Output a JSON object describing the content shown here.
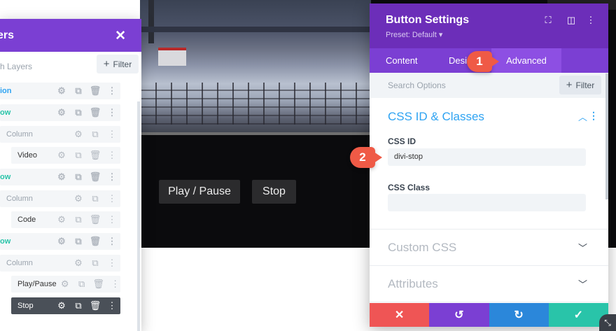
{
  "video": {
    "play_label": "Play / Pause",
    "stop_label": "Stop"
  },
  "layers": {
    "title": "ers",
    "search_placeholder": "h Layers",
    "filter_label": "Filter",
    "rows": [
      {
        "label": "ion",
        "kind": "section"
      },
      {
        "label": "ow",
        "kind": "row"
      },
      {
        "label": "Column",
        "kind": "column"
      },
      {
        "label": "Video",
        "kind": "module"
      },
      {
        "label": "ow",
        "kind": "row"
      },
      {
        "label": "Column",
        "kind": "column"
      },
      {
        "label": "Code",
        "kind": "module"
      },
      {
        "label": "ow",
        "kind": "row"
      },
      {
        "label": "Column",
        "kind": "column"
      },
      {
        "label": "Play/Pause",
        "kind": "module"
      },
      {
        "label": "Stop",
        "kind": "active"
      }
    ]
  },
  "settings": {
    "title": "Button Settings",
    "preset": "Preset: Default ▾",
    "tabs": {
      "content": "Content",
      "design": "Desi",
      "advanced": "Advanced"
    },
    "search_placeholder": "Search Options",
    "filter_label": "Filter",
    "css_section_title": "CSS ID & Classes",
    "css_id_label": "CSS ID",
    "css_id_value": "divi-stop",
    "css_class_label": "CSS Class",
    "css_class_value": "",
    "custom_css_title": "Custom CSS",
    "attributes_title": "Attributes"
  },
  "badges": {
    "one": "1",
    "two": "2"
  },
  "colors": {
    "purple_dark": "#6c2eb9",
    "purple": "#7b3fd3",
    "blue": "#2ea3f2",
    "teal": "#29c4a9",
    "red": "#ef5555",
    "badge": "#ef5a46"
  }
}
